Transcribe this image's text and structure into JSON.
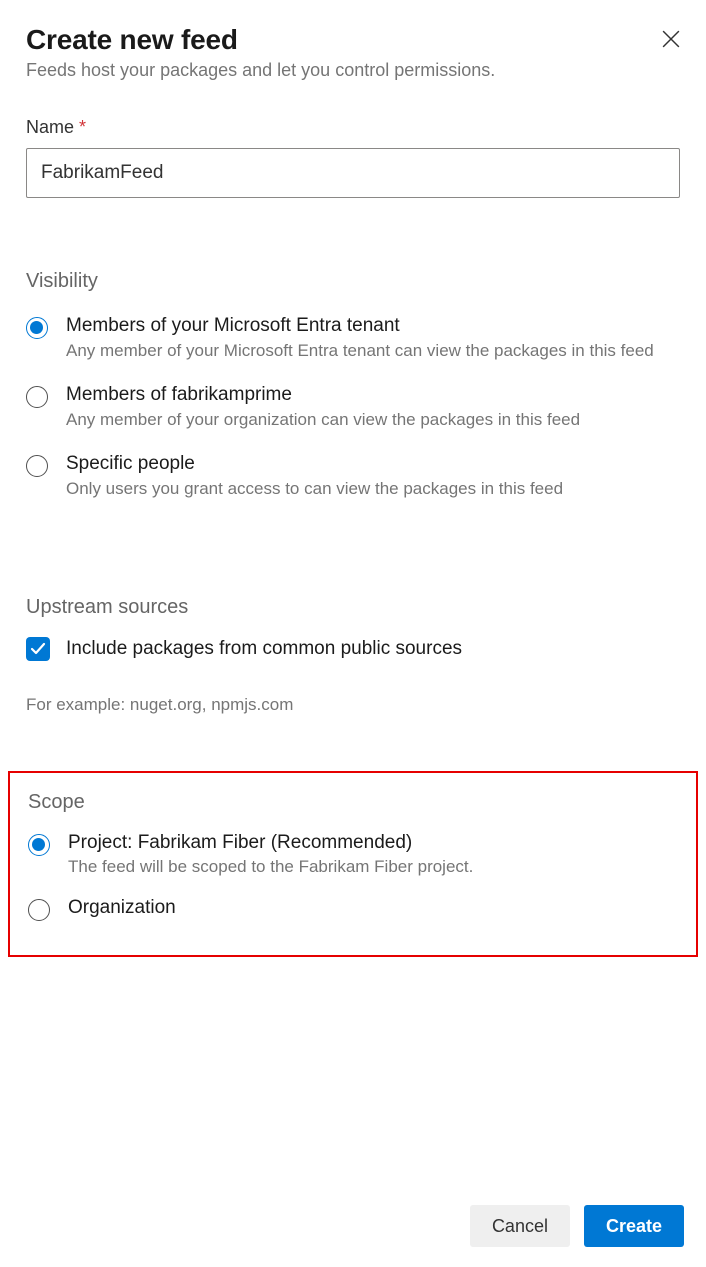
{
  "dialog": {
    "title": "Create new feed",
    "subtitle": "Feeds host your packages and let you control permissions."
  },
  "name": {
    "label": "Name",
    "required_marker": "*",
    "value": "FabrikamFeed"
  },
  "visibility": {
    "heading": "Visibility",
    "options": [
      {
        "label": "Members of your Microsoft Entra tenant",
        "desc": "Any member of your Microsoft Entra tenant can view the packages in this feed",
        "selected": true
      },
      {
        "label": "Members of fabrikamprime",
        "desc": "Any member of your organization can view the packages in this feed",
        "selected": false
      },
      {
        "label": "Specific people",
        "desc": "Only users you grant access to can view the packages in this feed",
        "selected": false
      }
    ]
  },
  "upstream": {
    "heading": "Upstream sources",
    "checkbox_label": "Include packages from common public sources",
    "example": "For example: nuget.org, npmjs.com"
  },
  "scope": {
    "heading": "Scope",
    "options": [
      {
        "label": "Project: Fabrikam Fiber (Recommended)",
        "desc": "The feed will be scoped to the Fabrikam Fiber project.",
        "selected": true
      },
      {
        "label": "Organization",
        "desc": "",
        "selected": false
      }
    ]
  },
  "footer": {
    "cancel": "Cancel",
    "create": "Create"
  }
}
